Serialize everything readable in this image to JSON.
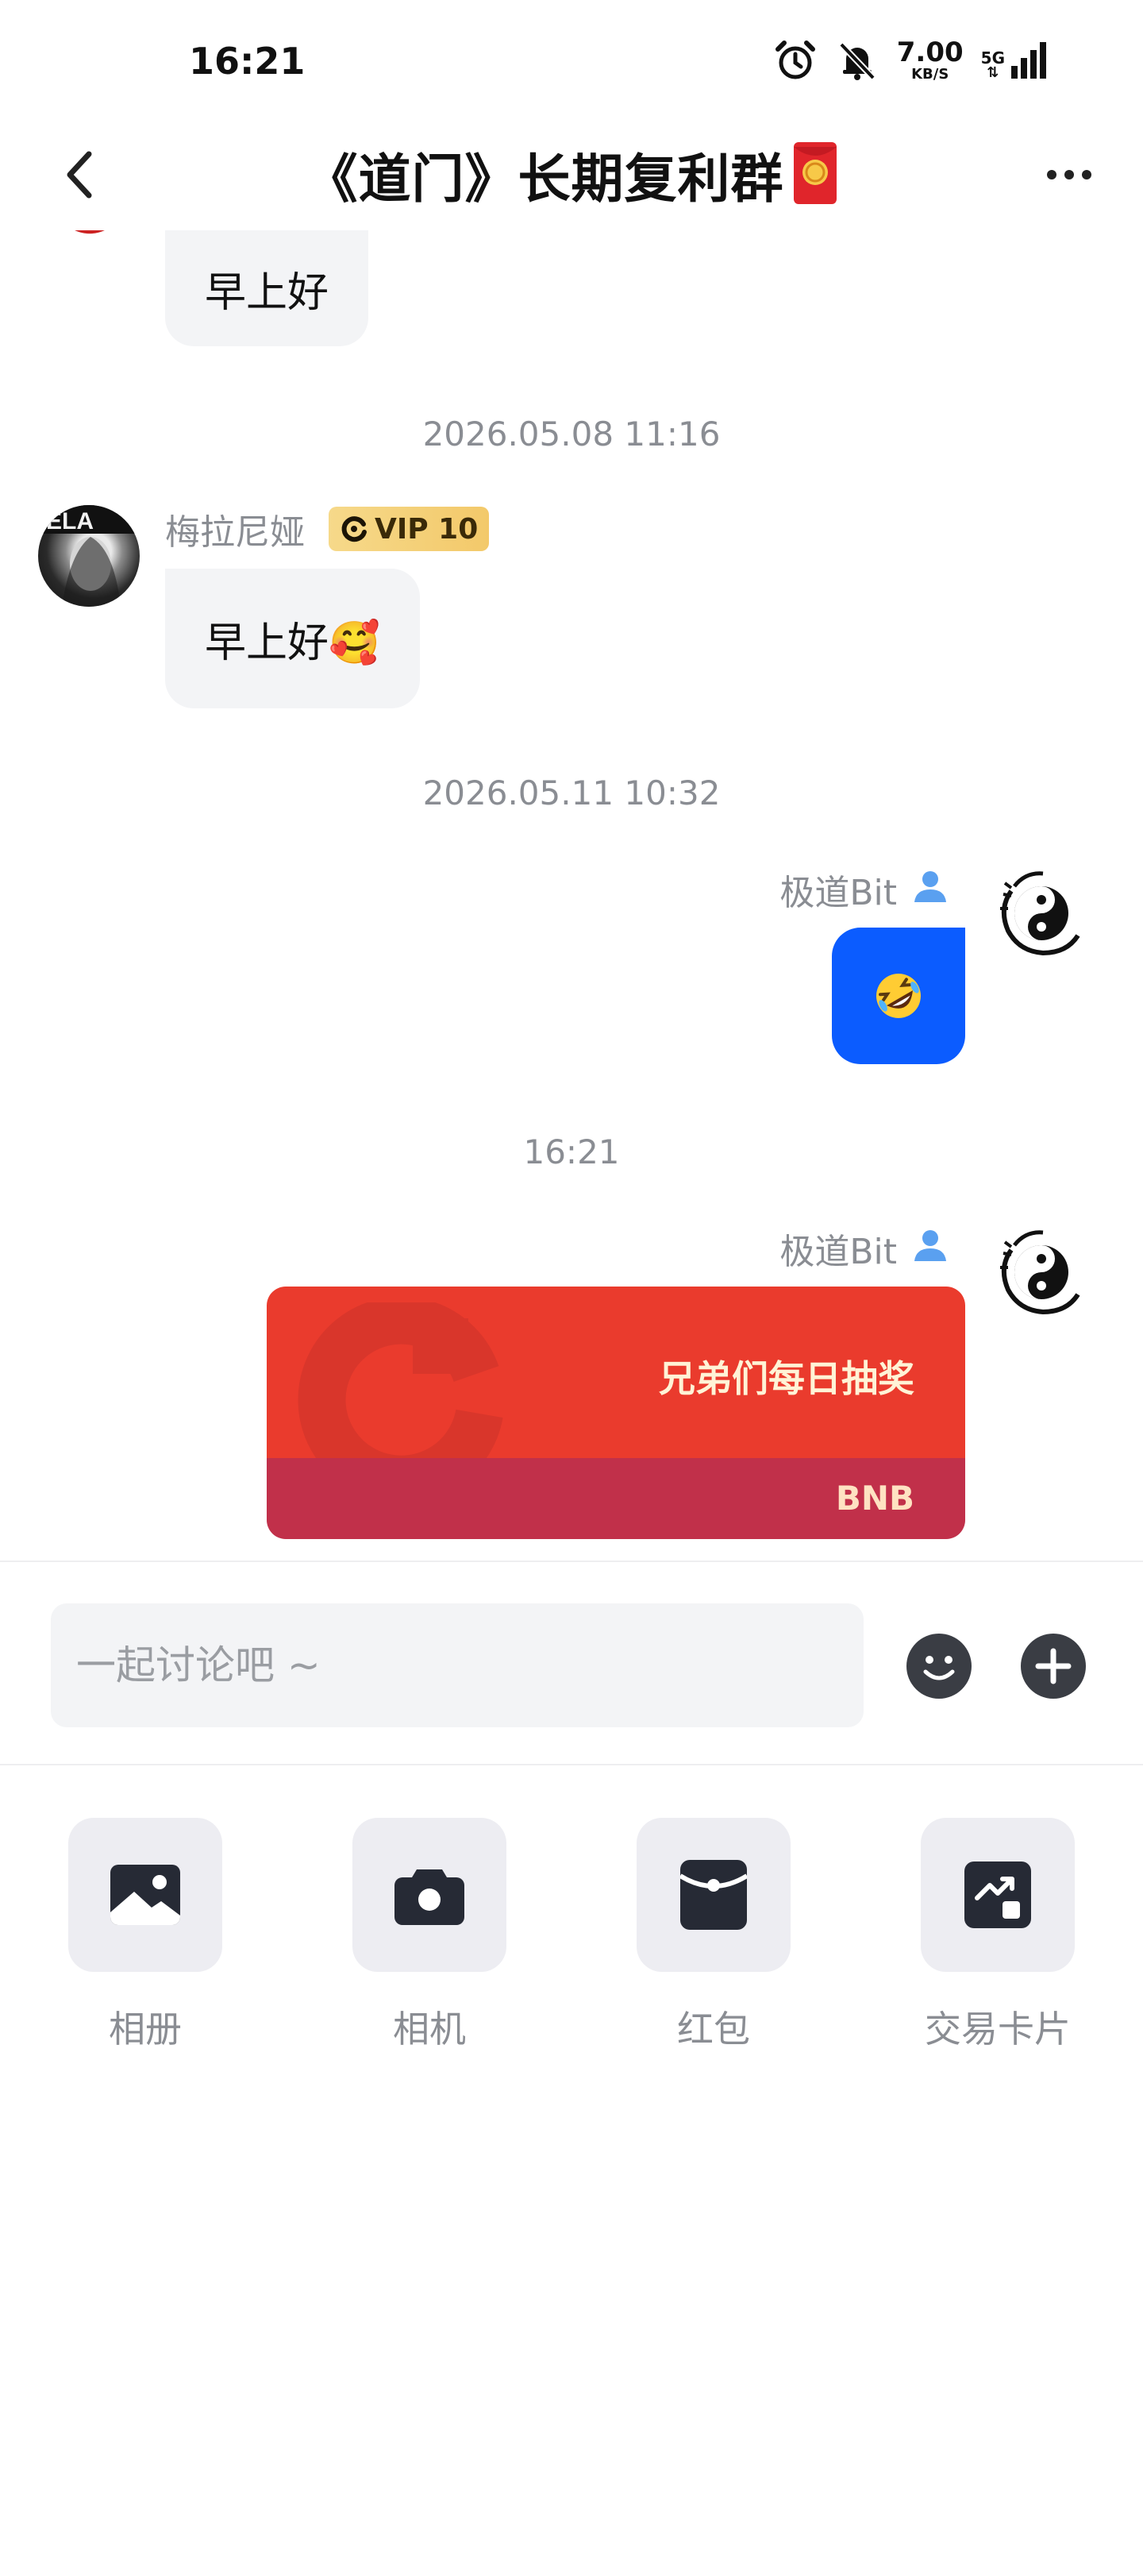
{
  "status_bar": {
    "time": "16:21",
    "net_speed": "7.00",
    "net_unit": "KB/S",
    "network": "5G",
    "icons": [
      "alarm-icon",
      "mute-icon",
      "signal-icon"
    ]
  },
  "header": {
    "title": "《道门》长期复利群",
    "title_emoji": "red-envelope-emoji",
    "back_icon": "chevron-left-icon",
    "more_icon": "more-dots-icon"
  },
  "messages": [
    {
      "type": "text",
      "direction": "incoming",
      "text": "早上好"
    },
    {
      "type": "timestamp",
      "text": "2026.05.08 11:16"
    },
    {
      "type": "text",
      "direction": "incoming",
      "sender": "梅拉尼娅",
      "badge": "VIP 10",
      "text": "早上好🥰"
    },
    {
      "type": "timestamp",
      "text": "2026.05.11 10:32"
    },
    {
      "type": "emoji",
      "direction": "outgoing",
      "sender": "极道Bit",
      "role_icon": "admin-icon",
      "emoji": "🤣"
    },
    {
      "type": "timestamp",
      "text": "16:21"
    },
    {
      "type": "red_packet",
      "direction": "outgoing",
      "sender": "极道Bit",
      "role_icon": "admin-icon",
      "title": "兄弟们每日抽奖",
      "coin": "BNB"
    }
  ],
  "input": {
    "placeholder": "一起讨论吧 ~",
    "value": ""
  },
  "tools": [
    {
      "label": "相册",
      "icon": "photo-album-icon"
    },
    {
      "label": "相机",
      "icon": "camera-icon"
    },
    {
      "label": "红包",
      "icon": "red-packet-icon"
    },
    {
      "label": "交易卡片",
      "icon": "trade-card-icon"
    }
  ],
  "colors": {
    "accent_blue": "#0b5cff",
    "red_packet_top": "#ea3b2d",
    "red_packet_bottom": "#c1304a",
    "vip_gold": "#f3c96a",
    "muted_text": "#8a8d93"
  }
}
